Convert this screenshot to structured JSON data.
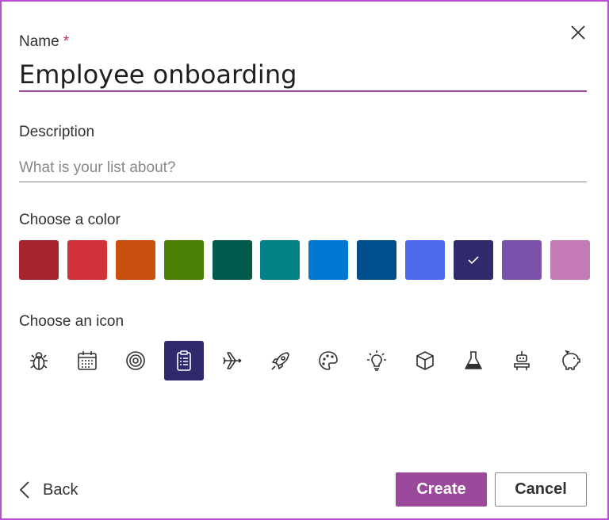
{
  "dialog": {
    "name_label": "Name",
    "required_mark": "*",
    "name_value": "Employee onboarding",
    "description_label": "Description",
    "description_placeholder": "What is your list about?",
    "color_label": "Choose a color",
    "icon_label": "Choose an icon"
  },
  "colors": [
    {
      "hex": "#a4262c",
      "selected": false
    },
    {
      "hex": "#d13438",
      "selected": false
    },
    {
      "hex": "#ca5010",
      "selected": false
    },
    {
      "hex": "#498205",
      "selected": false
    },
    {
      "hex": "#025c4d",
      "selected": false
    },
    {
      "hex": "#038387",
      "selected": false
    },
    {
      "hex": "#0078d4",
      "selected": false
    },
    {
      "hex": "#004e8c",
      "selected": false
    },
    {
      "hex": "#4f6bed",
      "selected": true
    },
    {
      "hex": "#2f2a6b",
      "selected": true
    },
    {
      "hex": "#7a52ac",
      "selected": false
    },
    {
      "hex": "#c27bb6",
      "selected": false
    }
  ],
  "icons": [
    {
      "name": "bug-icon",
      "selected": false
    },
    {
      "name": "calendar-icon",
      "selected": false
    },
    {
      "name": "target-icon",
      "selected": false
    },
    {
      "name": "clipboard-icon",
      "selected": true
    },
    {
      "name": "airplane-icon",
      "selected": false
    },
    {
      "name": "rocket-icon",
      "selected": false
    },
    {
      "name": "palette-icon",
      "selected": false
    },
    {
      "name": "lightbulb-icon",
      "selected": false
    },
    {
      "name": "cube-icon",
      "selected": false
    },
    {
      "name": "flask-icon",
      "selected": false
    },
    {
      "name": "robot-icon",
      "selected": false
    },
    {
      "name": "piggy-bank-icon",
      "selected": false
    }
  ],
  "footer": {
    "back_label": "Back",
    "create_label": "Create",
    "cancel_label": "Cancel"
  },
  "theme": {
    "accent": "#9b4a9b",
    "selected_icon_bg": "#2f2a6b",
    "icon_stroke": "#323130"
  }
}
